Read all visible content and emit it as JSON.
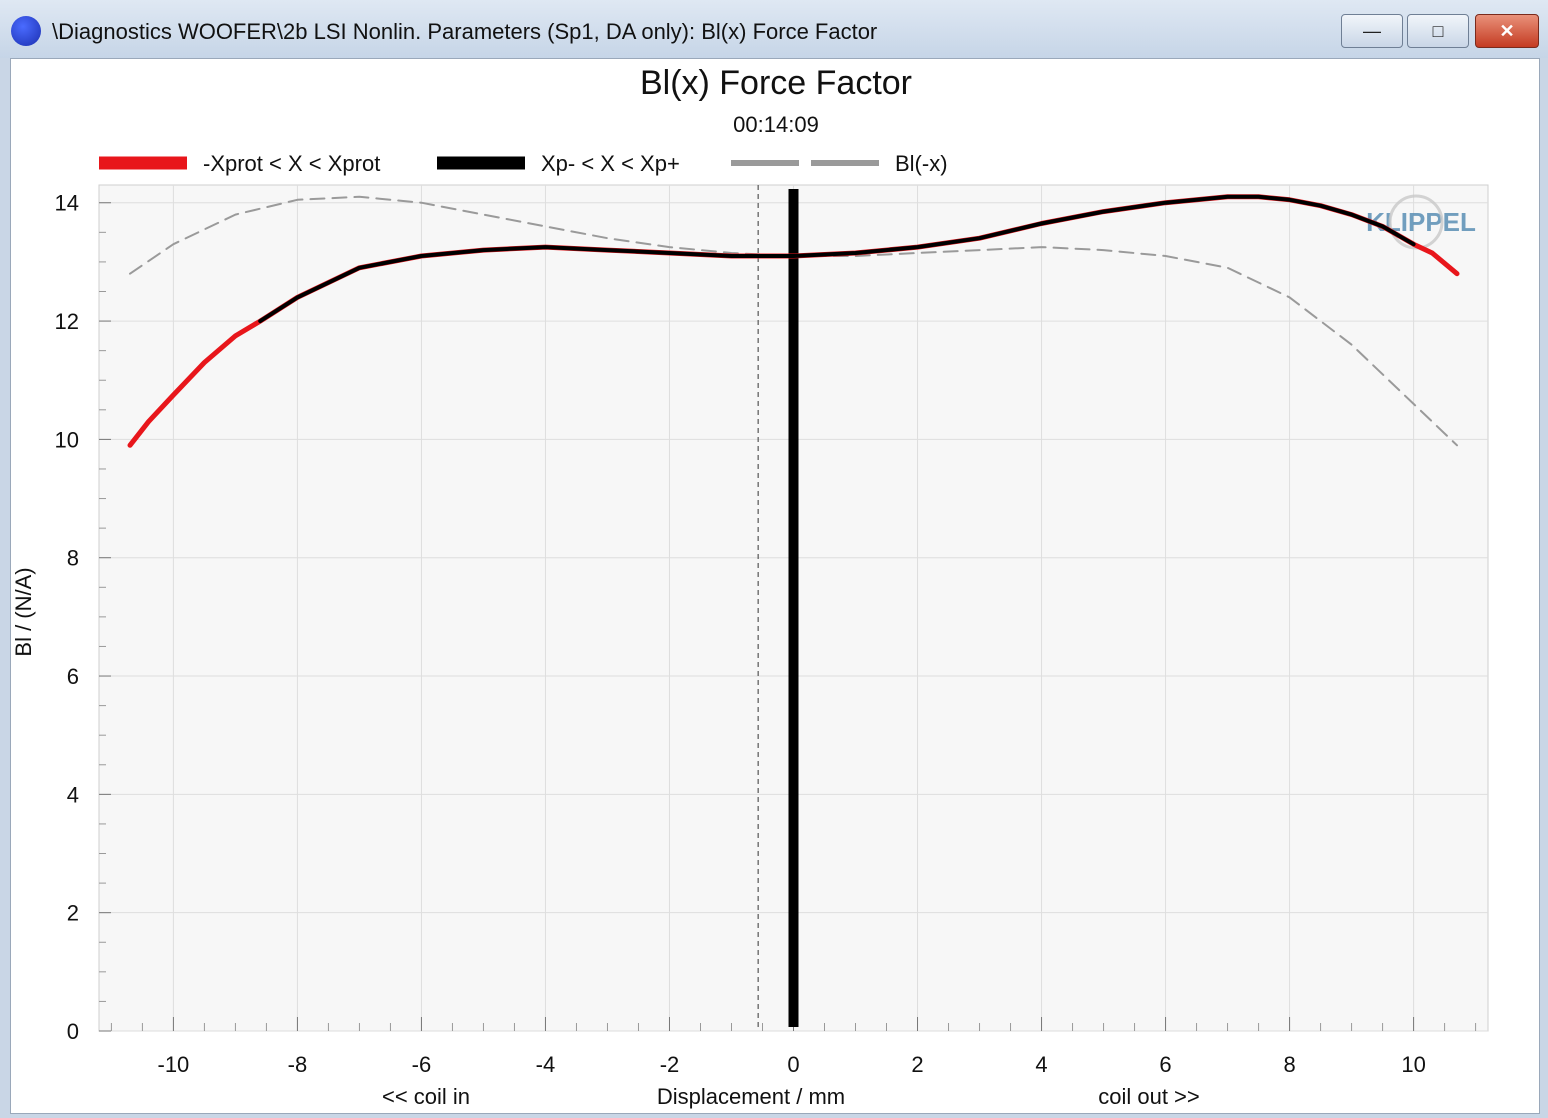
{
  "window": {
    "title": "\\Diagnostics WOOFER\\2b LSI Nonlin. Parameters (Sp1, DA only): Bl(x) Force Factor",
    "minimize": "—",
    "maximize": "□",
    "close": "✕"
  },
  "colors": {
    "red": "#e8161b",
    "black": "#000000",
    "gray": "#9a9a9a",
    "plot_bg": "#f7f7f7",
    "grid": "#dedede"
  },
  "chart_data": {
    "type": "line",
    "title": "Bl(x) Force Factor",
    "subtitle": "00:14:09",
    "xlabel": "Displacement / mm",
    "ylabel": "Bl / (N/A)",
    "xlabel_left": "<< coil in",
    "xlabel_right": "coil out >>",
    "xlim": [
      -11.2,
      11.2
    ],
    "ylim": [
      0,
      14.3
    ],
    "xticks": [
      -10,
      -8,
      -6,
      -4,
      -2,
      0,
      2,
      4,
      6,
      8,
      10
    ],
    "yticks": [
      0,
      2,
      4,
      6,
      8,
      10,
      12,
      14
    ],
    "grid": true,
    "legend_position": "top",
    "watermark": "KLIPPEL",
    "series": [
      {
        "name": "-Xprot < X < Xprot",
        "color": "#e8161b",
        "style": "solid",
        "x": [
          -10.7,
          -10.4,
          -10.0,
          -9.5,
          -9.0,
          -8.6,
          -8.0,
          -7.0,
          -6.0,
          -5.0,
          -4.0,
          -3.0,
          -2.0,
          -1.0,
          0.0,
          1.0,
          2.0,
          3.0,
          4.0,
          5.0,
          6.0,
          7.0,
          7.5,
          8.0,
          8.5,
          9.0,
          9.5,
          10.0,
          10.3,
          10.7
        ],
        "y": [
          9.9,
          10.3,
          10.75,
          11.3,
          11.75,
          12.0,
          12.4,
          12.9,
          13.1,
          13.2,
          13.25,
          13.2,
          13.15,
          13.1,
          13.1,
          13.15,
          13.25,
          13.4,
          13.65,
          13.85,
          14.0,
          14.1,
          14.1,
          14.05,
          13.95,
          13.8,
          13.6,
          13.3,
          13.15,
          12.8
        ]
      },
      {
        "name": "Xp- < X < Xp+",
        "color": "#000000",
        "style": "solid",
        "x": [
          -8.6,
          -8.0,
          -7.0,
          -6.0,
          -5.0,
          -4.0,
          -3.0,
          -2.0,
          -1.0,
          0.0,
          1.0,
          2.0,
          3.0,
          4.0,
          5.0,
          6.0,
          7.0,
          7.5,
          8.0,
          8.5,
          9.0,
          9.5,
          10.0
        ],
        "y": [
          12.0,
          12.4,
          12.9,
          13.1,
          13.2,
          13.25,
          13.2,
          13.15,
          13.1,
          13.1,
          13.15,
          13.25,
          13.4,
          13.65,
          13.85,
          14.0,
          14.1,
          14.1,
          14.05,
          13.95,
          13.8,
          13.6,
          13.3
        ]
      },
      {
        "name": "Bl(-x)",
        "color": "#9a9a9a",
        "style": "dashed",
        "x": [
          -10.7,
          -10.0,
          -9.0,
          -8.0,
          -7.0,
          -6.0,
          -5.0,
          -4.0,
          -3.0,
          -2.0,
          -1.0,
          0.0,
          1.0,
          2.0,
          3.0,
          4.0,
          5.0,
          6.0,
          7.0,
          8.0,
          9.0,
          10.0,
          10.7
        ],
        "y": [
          12.8,
          13.3,
          13.8,
          14.05,
          14.1,
          14.0,
          13.8,
          13.6,
          13.4,
          13.25,
          13.15,
          13.1,
          13.1,
          13.15,
          13.2,
          13.25,
          13.2,
          13.1,
          12.9,
          12.4,
          11.6,
          10.6,
          9.9
        ]
      }
    ],
    "markers": [
      {
        "name": "rest-position",
        "x": 0.0,
        "color": "#000000",
        "style": "solid-thick"
      },
      {
        "name": "offset-position",
        "x": -0.57,
        "color": "#555555",
        "style": "dashed-thin"
      }
    ]
  }
}
